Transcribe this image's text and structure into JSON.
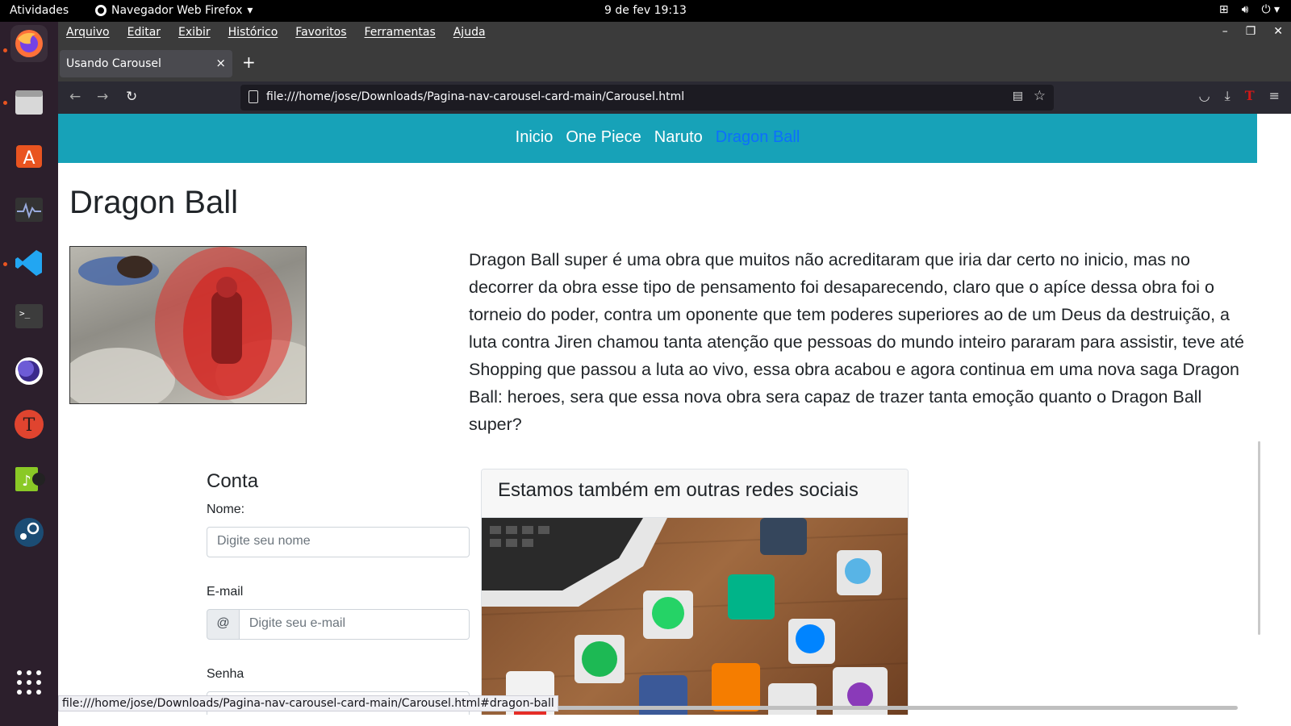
{
  "topbar": {
    "activities": "Atividades",
    "app_name": "Navegador Web Firefox",
    "clock": "9 de fev  19:13"
  },
  "window": {
    "menus": [
      "Arquivo",
      "Editar",
      "Exibir",
      "Histórico",
      "Favoritos",
      "Ferramentas",
      "Ajuda"
    ],
    "tab_title": "Usando Carousel",
    "url": "file:///home/jose/Downloads/Pagina-nav-carousel-card-main/Carousel.html",
    "status_url": "file:///home/jose/Downloads/Pagina-nav-carousel-card-main/Carousel.html#dragon-ball"
  },
  "site": {
    "nav": [
      {
        "label": "Inicio",
        "active": false
      },
      {
        "label": "One Piece",
        "active": false
      },
      {
        "label": "Naruto",
        "active": false
      },
      {
        "label": "Dragon Ball",
        "active": true
      }
    ],
    "heading": "Dragon Ball",
    "article": "Dragon Ball super é uma obra que muitos não acreditaram que iria dar certo no inicio, mas no decorrer da obra esse tipo de pensamento foi desaparecendo, claro que o apíce dessa obra foi o torneio do poder, contra um oponente que tem poderes superiores ao de um Deus da destruição, a luta contra Jiren chamou tanta atenção que pessoas do mundo inteiro pararam para assistir, teve até Shopping que passou a luta ao vivo, essa obra acabou e agora continua em uma nova saga Dragon Ball: heroes, sera que essa nova obra sera capaz de trazer tanta emoção quanto o Dragon Ball super?",
    "form": {
      "title": "Conta",
      "name_label": "Nome:",
      "name_placeholder": "Digite seu nome",
      "email_label": "E-mail",
      "email_addon": "@",
      "email_placeholder": "Digite seu e-mail",
      "password_label": "Senha",
      "password_value": "********"
    },
    "social_card": {
      "title": "Estamos também em outras redes sociais"
    }
  },
  "colors": {
    "site_nav_bg": "#17a2b8",
    "active_link": "#0d6efd",
    "ubuntu_orange": "#e95420"
  }
}
